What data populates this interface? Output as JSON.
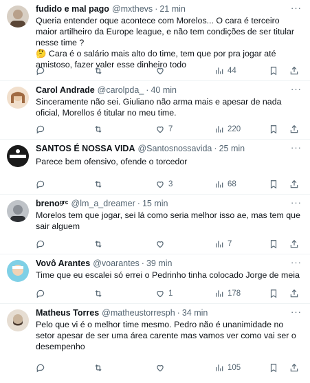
{
  "tweets": [
    {
      "name": "fudido e mal pago",
      "handle": "@mxthevs",
      "dot": "·",
      "time": "21 min",
      "text": "Queria entender oque acontece com Morelos... O cara é terceiro maior artilheiro da Europe league, e não tem condições de ser titular nesse time ?\n🤔 Cara é o salário mais alto do time, tem que por pra jogar até amistoso, fazer valer esse dinheiro todo",
      "replies": "",
      "retweets": "",
      "likes": "",
      "views": "44",
      "avatar_colors": [
        "#b8a08a",
        "#5a4636"
      ]
    },
    {
      "name": "Carol Andrade",
      "handle": "@carolpda_",
      "dot": "·",
      "time": "40 min",
      "text": "Sinceramente não sei. Giuliano não arma mais e apesar de nada oficial, Morellos é titular no meu time.",
      "replies": "",
      "retweets": "",
      "likes": "7",
      "views": "220",
      "avatar_colors": [
        "#e8c9a8",
        "#a06a42"
      ]
    },
    {
      "name": "SANTOS É NOSSA VIDA",
      "handle": "@Santosnossavida",
      "dot": "·",
      "time": "25 min",
      "text": "Parece bem ofensivo, ofende o torcedor",
      "replies": "",
      "retweets": "",
      "likes": "3",
      "views": "68",
      "avatar_colors": [
        "#1a1a1a",
        "#ffffff"
      ]
    },
    {
      "name": "brenoᵍʳᶜ",
      "handle": "@lm_a_dreamer",
      "dot": "·",
      "time": "15 min",
      "text": "Morelos tem que jogar, sei lá como seria melhor isso ae, mas tem que sair alguem",
      "replies": "",
      "retweets": "",
      "likes": "",
      "views": "7",
      "avatar_colors": [
        "#8a8f96",
        "#2c2f33"
      ]
    },
    {
      "name": "Vovô Arantes",
      "handle": "@voarantes",
      "dot": "·",
      "time": "39 min",
      "text": "Time que eu escalei só errei o Pedrinho tinha colocado Jorge de meia",
      "replies": "",
      "retweets": "",
      "likes": "1",
      "views": "178",
      "avatar_colors": [
        "#7fd0e6",
        "#f2d3b6"
      ]
    },
    {
      "name": "Matheus Torres",
      "handle": "@matheustorresph",
      "dot": "·",
      "time": "34 min",
      "text": "Pelo que vi é o melhor time mesmo. Pedro não é unanimidade no setor apesar de ser uma área carente mas vamos ver como vai ser o desempenho",
      "replies": "",
      "retweets": "",
      "likes": "",
      "views": "105",
      "avatar_colors": [
        "#c9b49c",
        "#4a3a2e"
      ]
    }
  ],
  "more_label": "···",
  "icons": {
    "reply": "reply-icon",
    "retweet": "retweet-icon",
    "like": "heart-icon",
    "views": "views-icon",
    "bookmark": "bookmark-icon",
    "share": "share-icon"
  },
  "colors": {
    "text": "#0f1419",
    "muted": "#536471",
    "divider": "#eff3f4"
  }
}
